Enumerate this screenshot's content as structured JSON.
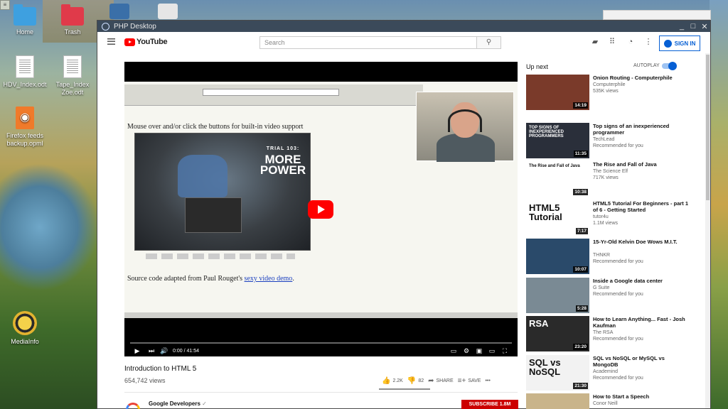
{
  "desktop": {
    "icons": [
      {
        "label": "Home"
      },
      {
        "label": "Trash"
      },
      {
        "label": "HDV_Index.odt"
      },
      {
        "label": "Tape_Index Zoe.odt"
      },
      {
        "label": "Firefox feeds backup.opml"
      },
      {
        "label": "MediaInfo"
      }
    ]
  },
  "window": {
    "title": "PHP Desktop",
    "minimize": "_",
    "maximize": "□",
    "close": "✕"
  },
  "header": {
    "logo_text": "YouTube",
    "search_placeholder": "Search",
    "signin_label": "SIGN IN"
  },
  "player": {
    "page_text": "Mouse over and/or click the buttons for built-in video support",
    "clip_caption_small": "TRIAL 103:",
    "clip_caption": "MORE POWER",
    "source_prefix": "Source code adapted from Paul Rouget's ",
    "source_link": "sexy video demo",
    "source_suffix": ".",
    "time": "0:00 / 41:54",
    "progress": 0
  },
  "video": {
    "title": "Introduction to HTML 5",
    "views": "654,742 views",
    "likes": "2.2K",
    "dislikes": "82",
    "share": "SHARE",
    "save": "SAVE",
    "more": "•••",
    "channel": "Google Developers",
    "subscribe": "SUBSCRIBE 1.8M"
  },
  "sidebar": {
    "up_next": "Up next",
    "autoplay": "AUTOPLAY",
    "autoplay_on": true,
    "items": [
      {
        "title": "Onion Routing - Computerphile",
        "channel": "Computerphile",
        "meta": "535K views",
        "duration": "14:19",
        "thumb_text": "",
        "thumb_color": "#7a3a2a"
      },
      {
        "title": "Top signs of an inexperienced programmer",
        "channel": "TechLead",
        "meta": "Recommended for you",
        "duration": "11:35",
        "thumb_text": "TOP SIGNS OF INEXPERIENCED PROGRAMMERS",
        "thumb_color": "#2a2f3a"
      },
      {
        "title": "The Rise and Fall of Java",
        "channel": "The Science Elf",
        "meta": "717K views",
        "duration": "10:38",
        "thumb_text": "The Rise and Fall of Java",
        "thumb_color": "#ffffff"
      },
      {
        "title": "HTML5 Tutorial For Beginners - part 1 of 6 - Getting Started",
        "channel": "tutor4u",
        "meta": "1.1M views",
        "duration": "7:17",
        "thumb_text": "HTML5 Tutorial",
        "thumb_color": "#ffffff"
      },
      {
        "title": "15-Yr-Old Kelvin Doe Wows M.I.T.",
        "channel": "THNKR",
        "meta": "Recommended for you",
        "duration": "10:07",
        "thumb_text": "",
        "thumb_color": "#2a4a6a"
      },
      {
        "title": "Inside a Google data center",
        "channel": "G Suite",
        "meta": "Recommended for you",
        "duration": "5:28",
        "thumb_text": "",
        "thumb_color": "#7a8a94"
      },
      {
        "title": "How to Learn Anything... Fast - Josh Kaufman",
        "channel": "The RSA",
        "meta": "Recommended for you",
        "duration": "23:20",
        "thumb_text": "RSA",
        "thumb_color": "#2a2a2a"
      },
      {
        "title": "SQL vs NoSQL or MySQL vs MongoDB",
        "channel": "Academind",
        "meta": "Recommended for you",
        "duration": "21:30",
        "thumb_text": "SQL vs NoSQL",
        "thumb_color": "#f2f2f2"
      },
      {
        "title": "How to Start a Speech",
        "channel": "Conor Neill",
        "meta": "",
        "duration": "",
        "thumb_text": "",
        "thumb_color": "#c9b48a"
      }
    ]
  }
}
